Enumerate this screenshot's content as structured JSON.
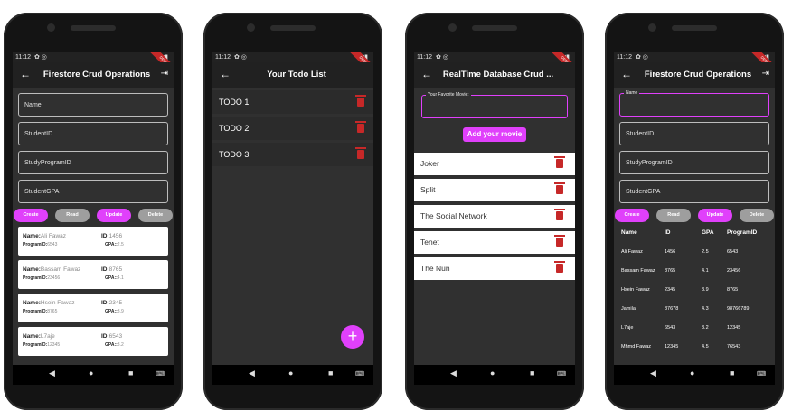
{
  "status": {
    "time": "11:12"
  },
  "screen1": {
    "title": "Firestore Crud Operations",
    "fields": [
      "Name",
      "StudentID",
      "StudyProgramID",
      "StudentGPA"
    ],
    "buttons": {
      "create": "Create",
      "read": "Read",
      "update": "Update",
      "delete": "Delete"
    },
    "labels": {
      "name": "Name:",
      "id": "ID:",
      "program": "ProgramID:",
      "gpa": "GPA::"
    },
    "students": [
      {
        "name": "Ali Fawaz",
        "id": "1456",
        "program": "6543",
        "gpa": "2.5"
      },
      {
        "name": "Bassam Fawaz",
        "id": "8765",
        "program": "23456",
        "gpa": "4.1"
      },
      {
        "name": "Hsein Fawaz",
        "id": "2345",
        "program": "8765",
        "gpa": "3.9"
      },
      {
        "name": "L7aje",
        "id": "6543",
        "program": "12345",
        "gpa": "3.2"
      }
    ]
  },
  "screen2": {
    "title": "Your Todo List",
    "todos": [
      "TODO 1",
      "TODO 2",
      "TODO 3"
    ],
    "fab": "+"
  },
  "screen3": {
    "title": "RealTime Database Crud ...",
    "field_label": "Your Favorite Movie:",
    "add_button": "Add your movie",
    "movies": [
      "Joker",
      "Split",
      "The Social Network",
      "Tenet",
      "The Nun"
    ]
  },
  "screen4": {
    "title": "Firestore Crud Operations",
    "fields": [
      "Name",
      "StudentID",
      "StudyProgramID",
      "StudentGPA"
    ],
    "buttons": {
      "create": "Create",
      "read": "Read",
      "update": "Update",
      "delete": "Delete"
    },
    "columns": [
      "Name",
      "ID",
      "GPA",
      "ProgramID"
    ],
    "rows": [
      [
        "Ali Fawaz",
        "1456",
        "2.5",
        "6543"
      ],
      [
        "Bassam Fawaz",
        "8765",
        "4.1",
        "23456"
      ],
      [
        "Hsein Fawaz",
        "2345",
        "3.9",
        "8765"
      ],
      [
        "Jamila",
        "87678",
        "4.3",
        "98766789"
      ],
      [
        "L7aje",
        "6543",
        "3.2",
        "12345"
      ],
      [
        "Mhmd Fawaz",
        "12345",
        "4.5",
        "76543"
      ]
    ]
  },
  "colors": {
    "accent": "#e040fb",
    "delete": "#c62828",
    "background": "#303030"
  }
}
